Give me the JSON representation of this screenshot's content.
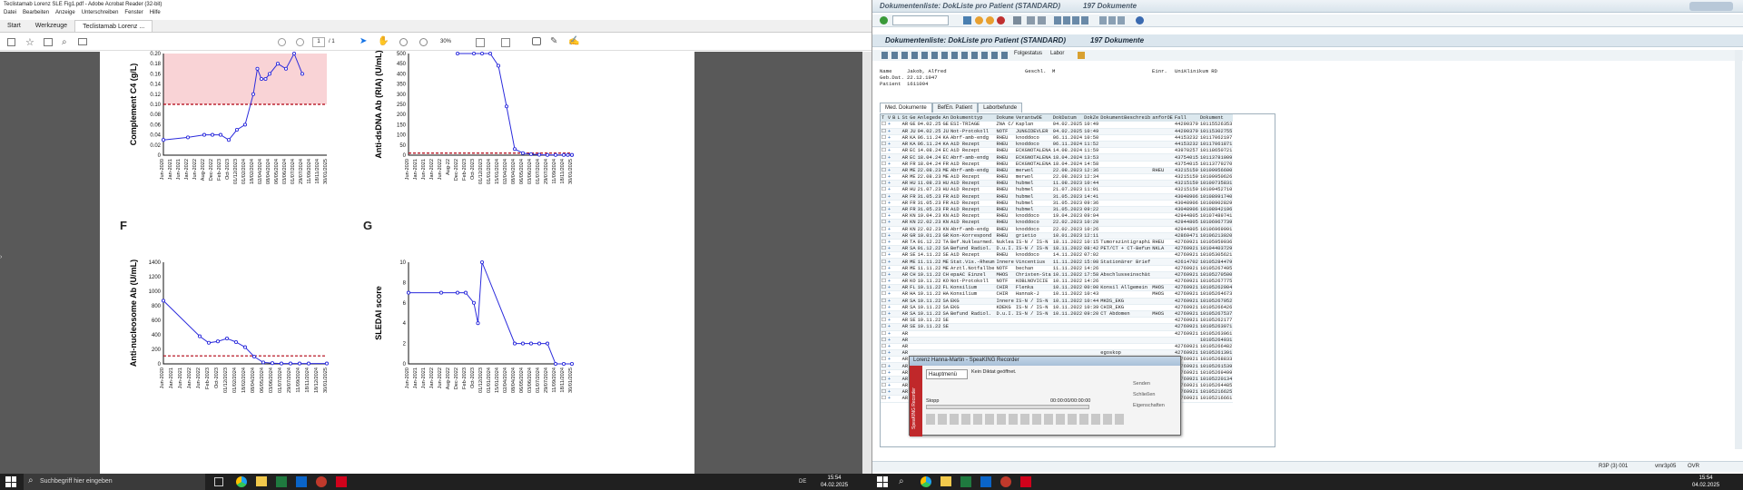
{
  "acrobat": {
    "title": "Teclistamab Lorenz SLE Fig1.pdf - Adobe Acrobat Reader (32-bit)",
    "menu": [
      "Datei",
      "Bearbeiten",
      "Anzeige",
      "Unterschreiben",
      "Fenster",
      "Hilfe"
    ],
    "tabs": [
      "Start",
      "Werkzeuge",
      "Teclistamab Lorenz ..."
    ],
    "page_current": "1",
    "page_total": "/ 1",
    "zoom": "30%"
  },
  "taskbar_left": {
    "search_placeholder": "Suchbegriff hier eingeben",
    "time": "15:54",
    "date": "04.02.2025",
    "lang": "DE"
  },
  "taskbar_right": {
    "time": "15:54",
    "date": "04.02.2025"
  },
  "panel_labels": {
    "f": "F",
    "g": "G"
  },
  "chart_data": [
    {
      "type": "line",
      "ylabel": "Complement C4 (g/L)",
      "yticks": [
        "0",
        "0.02",
        "0.04",
        "0.06",
        "0.08",
        "0.10",
        "0.12",
        "0.14",
        "0.16",
        "0.18",
        "0.20"
      ],
      "ylim": [
        0,
        0.2
      ],
      "threshold": 0.1,
      "x_labels": [
        "Jun-2020",
        "Jan-2021",
        "Jun-2021",
        "Jan-2022",
        "Jun-2022",
        "Aug-2022",
        "Dec-2022",
        "Feb-2023",
        "Oct-2023",
        "01/12/2023",
        "01/02/2024",
        "18/02/2024",
        "02/04/2024",
        "08/04/2024",
        "06/05/2024",
        "03/06/2024",
        "01/07/2024",
        "29/07/2024",
        "11/09/2024",
        "18/11/2024",
        "30/01/2025"
      ],
      "values": [
        0.03,
        0.035,
        0.04,
        0.04,
        0.04,
        0.03,
        0.05,
        0.06,
        0.12,
        0.17,
        0.15,
        0.15,
        0.16,
        0.18,
        0.17,
        0.2,
        0.16
      ],
      "x_index": [
        0,
        3,
        5,
        6,
        7,
        8,
        9,
        10,
        11,
        11.5,
        12,
        12.5,
        13,
        14,
        15,
        16,
        17,
        18,
        19,
        19.5,
        20
      ]
    },
    {
      "type": "line",
      "ylabel": "Anti-dsDNA Ab (RIA) (U/mL)",
      "yticks": [
        "0",
        "50",
        "100",
        "150",
        "200",
        "250",
        "300",
        "350",
        "400",
        "450",
        "500"
      ],
      "ylim": [
        0,
        500
      ],
      "threshold": 10,
      "x_labels": [
        "Jun-2020",
        "Jan-2021",
        "Jun-2021",
        "Jan-2022",
        "Jun-2022",
        "Aug-22",
        "Dec-2022",
        "Feb-2023",
        "Oct-2023",
        "01/12/2023",
        "01/01/2024",
        "15/01/2024",
        "02/04/2024",
        "08/04/2024",
        "06/05/2024",
        "03/06/2024",
        "01/07/2024",
        "29/07/2024",
        "11/09/2024",
        "18/11/2024",
        "30/01/2025"
      ],
      "values": [
        525,
        510,
        520,
        500,
        440,
        240,
        30,
        10,
        5,
        2,
        1,
        1,
        1,
        1,
        1,
        1
      ],
      "x_index": [
        6,
        8,
        9,
        10,
        11,
        12,
        13,
        14,
        15,
        16,
        17,
        18,
        19,
        19.5,
        20,
        20
      ]
    },
    {
      "type": "line",
      "ylabel": "Anti-nucleosome Ab (U/mL)",
      "yticks": [
        "0",
        "200",
        "400",
        "600",
        "800",
        "1000",
        "1200",
        "1400"
      ],
      "ylim": [
        0,
        1400
      ],
      "threshold": 110,
      "x_labels": [
        "Jun-2020",
        "Jan-2021",
        "Jun-2021",
        "Jan-2022",
        "Jun-2022",
        "Feb-2023",
        "Oct-2023",
        "01/12/2023",
        "01/02/2024",
        "18/02/2024",
        "08/04/2024",
        "06/05/2024",
        "03/06/2024",
        "01/07/2024",
        "29/07/2024",
        "11/09/2024",
        "18/11/2024",
        "18/12/2024",
        "30/01/2025"
      ],
      "values": [
        870,
        380,
        290,
        310,
        350,
        300,
        230,
        100,
        20,
        10,
        5,
        5,
        5,
        5,
        5
      ],
      "x_index": [
        0,
        4,
        5,
        6,
        7,
        8,
        9,
        10,
        11,
        12,
        13,
        14,
        15,
        16,
        18
      ]
    },
    {
      "type": "line",
      "ylabel": "SLEDAI score",
      "yticks": [
        "0",
        "2",
        "4",
        "6",
        "8",
        "10"
      ],
      "ylim": [
        0,
        10
      ],
      "x_labels": [
        "Jun-2020",
        "Jan-2021",
        "Jun-2021",
        "Jan-2022",
        "Jun-2022",
        "Aug-2022",
        "Dec-2022",
        "Feb-2023",
        "Oct-2023",
        "01/12/2023",
        "01/01/2024",
        "15/01/2024",
        "02/04/2024",
        "08/04/2024",
        "06/05/2024",
        "03/06/2024",
        "01/07/2024",
        "29/07/2024",
        "11/09/2024",
        "18/11/2024",
        "30/01/2025"
      ],
      "values": [
        7,
        7,
        7,
        7,
        6,
        4,
        10,
        2,
        2,
        2,
        2,
        2,
        0,
        0,
        0
      ],
      "x_index": [
        0,
        4,
        6,
        7,
        8,
        8.5,
        9,
        13,
        14,
        15,
        16,
        17,
        18,
        19,
        20
      ]
    }
  ],
  "sap": {
    "title": "Dokumentenliste: DokListe pro Patient (STANDARD)",
    "count": "197 Dokumente",
    "folgestatus": "Folgestatus",
    "labor": "Labor",
    "name_label": "Name",
    "name": "Jakob, Alfred",
    "geschl_label": "Geschl.",
    "geschl": "M",
    "einr_label": "Einr.",
    "einr": "UniKlinikum RD",
    "gebdat_label": "Geb.Dat.",
    "gebdat": "22.12.1947",
    "patient_label": "Patient",
    "patient": "1611094",
    "tabs": [
      "Med. Dokumente",
      "BefEn. Patient",
      "Laborbefunde"
    ],
    "columns": [
      "T",
      "V",
      "B",
      "L",
      "St",
      "Ge",
      "Anlegede",
      "An",
      "Dokumenttyp",
      "Dokume",
      "VerantwOE",
      "DokDatum",
      "DokZe",
      "DokumentBeschreib",
      "anforOE",
      "Fall",
      "Dokument"
    ],
    "rows": [
      [
        "AR",
        "GE",
        "04.02.25",
        "GE",
        "ESI-TRIAGE",
        "ZNA C/",
        "Kaplan",
        "04.02.2025",
        "10:49",
        "",
        "",
        "44290379",
        "10115526353"
      ],
      [
        "AR",
        "JU",
        "04.02.25",
        "JU",
        "Not-Protokoll",
        "NOTF",
        "JUNGIDEVLER",
        "04.02.2025",
        "10:49",
        "",
        "",
        "44290379",
        "10115302755"
      ],
      [
        "AR",
        "KA",
        "06.11.24",
        "KA",
        "Abrf-amb-endg",
        "RHEU",
        "knoddoco",
        "06.11.2024",
        "10:50",
        "",
        "",
        "44153232",
        "10117062197"
      ],
      [
        "AR",
        "KA",
        "06.11.24",
        "KA",
        "AiD Rezept",
        "RHEU",
        "knoddoco",
        "06.11.2024",
        "11:52",
        "",
        "",
        "44153232",
        "10117061871"
      ],
      [
        "AR",
        "EC",
        "14.08.24",
        "EC",
        "AiD Rezept",
        "RHEU",
        "ECKGNOTALENA",
        "14.08.2024",
        "11:59",
        "",
        "",
        "43970257",
        "10118650721"
      ],
      [
        "AR",
        "EC",
        "18.04.24",
        "EC",
        "Abrf-amb-endg",
        "RHEU",
        "ECKGNOTALENA",
        "18.04.2024",
        "13:53",
        "",
        "",
        "43754015",
        "10113781009"
      ],
      [
        "AR",
        "FR",
        "18.04.24",
        "FR",
        "AiD Rezept",
        "RHEU",
        "ECKGNOTALENA",
        "18.04.2024",
        "14:58",
        "",
        "",
        "43754015",
        "10113779270"
      ],
      [
        "AR",
        "ME",
        "22.08.23",
        "ME",
        "Abrf-amb-endg",
        "RHEU",
        "merwol",
        "22.08.2023",
        "12:36",
        "",
        "RHEU",
        "43215159",
        "10109956600"
      ],
      [
        "AR",
        "ME",
        "22.08.23",
        "ME",
        "AiD Rezept",
        "RHEU",
        "merwol",
        "22.08.2023",
        "12:34",
        "",
        "",
        "43215159",
        "10109950626"
      ],
      [
        "AR",
        "HU",
        "11.08.23",
        "HU",
        "AiD Rezept",
        "RHEU",
        "hubmel",
        "11.08.2023",
        "10:44",
        "",
        "",
        "43215159",
        "10109735831"
      ],
      [
        "AR",
        "HU",
        "21.07.23",
        "HU",
        "AiD Rezept",
        "RHEU",
        "hubmel",
        "21.07.2023",
        "11:01",
        "",
        "",
        "43215159",
        "10109452710"
      ],
      [
        "AR",
        "FR",
        "31.05.23",
        "FR",
        "AiD Rezept",
        "RHEU",
        "hubmel",
        "31.05.2023",
        "14:41",
        "",
        "",
        "43048906",
        "10108991740"
      ],
      [
        "AR",
        "FR",
        "31.05.23",
        "FR",
        "AiD Rezept",
        "RHEU",
        "hubmel",
        "31.05.2023",
        "09:36",
        "",
        "",
        "43048906",
        "10108902829"
      ],
      [
        "AR",
        "FR",
        "31.05.23",
        "FR",
        "AiD Rezept",
        "RHEU",
        "hubmel",
        "31.05.2023",
        "09:22",
        "",
        "",
        "43048906",
        "10108942196"
      ],
      [
        "AR",
        "KN",
        "19.04.23",
        "KN",
        "AiD Rezept",
        "RHEU",
        "knoddoco",
        "19.04.2023",
        "09:04",
        "",
        "",
        "42944805",
        "10107489741"
      ],
      [
        "AR",
        "KN",
        "22.02.23",
        "KN",
        "AiD Rezept",
        "RHEU",
        "knoddoco",
        "22.02.2023",
        "10:20",
        "",
        "",
        "42944805",
        "10106967739"
      ],
      [
        "AR",
        "KN",
        "22.02.23",
        "KN",
        "Abrf-amb-endg",
        "RHEU",
        "knoddoco",
        "22.02.2023",
        "10:26",
        "",
        "",
        "42944805",
        "10106969991"
      ],
      [
        "AR",
        "GR",
        "10.01.23",
        "GR",
        "Kon-Korrespond",
        "RHEU",
        "grietio",
        "10.01.2023",
        "12:11",
        "",
        "",
        "42869471",
        "10106213020"
      ],
      [
        "AR",
        "TA",
        "01.12.22",
        "TA",
        "Bef.Nuklearmed.",
        "Nuklea",
        "IS-N / IS-N",
        "18.11.2022",
        "10:15",
        "Tumorszintigraphi",
        "RHEU",
        "42769921",
        "10105959936"
      ],
      [
        "AR",
        "SA",
        "01.12.22",
        "SA",
        "Befund Radiol.",
        "D.u.I.",
        "IS-N / IS-N",
        "18.11.2022",
        "08:42",
        "PET/CT + CT-Befun",
        "NKLA",
        "42769921",
        "10104403729"
      ],
      [
        "AR",
        "SE",
        "14.11.22",
        "SE",
        "AiD Rezept",
        "RHEU",
        "knoddoco",
        "14.11.2022",
        "07:02",
        "",
        "",
        "42769921",
        "10105305621"
      ],
      [
        "AR",
        "ME",
        "11.11.22",
        "ME",
        "Stat.Vis.-Rheum",
        "Innere",
        "Vincentius",
        "11.11.2022",
        "15:08",
        "Stationärer Brief",
        "",
        "42614702",
        "10105284479"
      ],
      [
        "AR",
        "ME",
        "11.11.22",
        "ME",
        "Arztl.Notfallbe",
        "NOTF",
        "bechan",
        "11.11.2022",
        "14:26",
        "",
        "",
        "42769921",
        "10105267495"
      ],
      [
        "AR",
        "CH",
        "10.11.22",
        "CH",
        "epaAC Einzel",
        "MHOS",
        "Christen-Sta",
        "10.11.2022",
        "17:58",
        "Abschlusseinschät",
        "",
        "42769921",
        "10105270500"
      ],
      [
        "AR",
        "KO",
        "10.11.22",
        "KO",
        "Not-Protokoll",
        "NOTF",
        "KOBLNOVICIE",
        "10.11.2022",
        "14:26",
        "",
        "",
        "42769921",
        "10105267775"
      ],
      [
        "AR",
        "FL",
        "10.11.22",
        "FL",
        "Konsilium",
        "CHIR",
        "Flenka",
        "10.11.2022",
        "00:00",
        "Konsil Allgemein",
        "MHOS",
        "42769921",
        "10105262904"
      ],
      [
        "AR",
        "HA",
        "10.11.22",
        "HA",
        "Konsilium",
        "CHIR",
        "Hannak-J",
        "10.11.2022",
        "10:43",
        "",
        "MHOS",
        "42769921",
        "10105264673"
      ],
      [
        "AR",
        "SA",
        "10.11.22",
        "SA",
        "EKG",
        "Innere",
        "IS-N / IS-N",
        "10.11.2022",
        "10:44",
        "MKDS_EKG",
        "",
        "42769921",
        "10105267952"
      ],
      [
        "AR",
        "SA",
        "10.11.22",
        "SA",
        "EKG",
        "KDEKG",
        "IS-N / IS-N",
        "10.11.2022",
        "10:39",
        "CHIR_EKG",
        "",
        "42769921",
        "10105266426"
      ],
      [
        "AR",
        "SA",
        "10.11.22",
        "SA",
        "Befund Radiol.",
        "D.u.I.",
        "IS-N / IS-N",
        "10.11.2022",
        "09:20",
        "CT Abdomen",
        "MHOS",
        "42769921",
        "10105267537"
      ],
      [
        "AR",
        "SE",
        "10.11.22",
        "SE",
        "",
        "",
        "",
        "",
        "",
        "",
        "",
        "42769921",
        "10105262177"
      ],
      [
        "AR",
        "SE",
        "10.11.22",
        "SE",
        "",
        "",
        "",
        "",
        "",
        "",
        "",
        "42769921",
        "10105263071"
      ],
      [
        "AR",
        "",
        "",
        "",
        "",
        "",
        "",
        "",
        "",
        "",
        "",
        "42769921",
        "10105263061"
      ],
      [
        "AR",
        "",
        "",
        "",
        "",
        "",
        "",
        "",
        "",
        "",
        "",
        "",
        "10105264931"
      ],
      [
        "AR",
        "",
        "",
        "",
        "",
        "",
        "",
        "",
        "",
        "",
        "",
        "42769921",
        "10105266482"
      ],
      [
        "AR",
        "",
        "",
        "",
        "",
        "",
        "",
        "",
        "",
        "egoskop",
        "",
        "42769921",
        "10105261391"
      ],
      [
        "AR",
        "",
        "",
        "",
        "",
        "",
        "",
        "",
        "",
        "",
        "",
        "42769921",
        "10105268833"
      ],
      [
        "AR",
        "",
        "",
        "",
        "",
        "",
        "",
        "",
        "",
        "",
        "DRHC",
        "42769921",
        "10105261539"
      ],
      [
        "AR",
        "",
        "",
        "",
        "",
        "",
        "",
        "",
        "",
        "",
        "",
        "42769921",
        "10105269499"
      ],
      [
        "AR",
        "",
        "",
        "",
        "",
        "",
        "",
        "",
        "",
        "",
        "DRHC",
        "42769921",
        "10105220134"
      ],
      [
        "AR",
        "",
        "",
        "",
        "",
        "",
        "",
        "",
        "",
        "ief",
        "",
        "42769921",
        "10105264485"
      ],
      [
        "AR",
        "",
        "",
        "",
        "",
        "",
        "",
        "",
        "",
        "",
        "",
        "42769921",
        "10105216625"
      ],
      [
        "AR",
        "MU",
        "08.11.22",
        "MU",
        "epaAC Einzel",
        "MHOS",
        "szcideni",
        "08.11.2022",
        "13:14",
        "Ersteinschätzung",
        "",
        "42769921",
        "10105216661"
      ]
    ],
    "status": {
      "server": "R3P (3) 001",
      "user": "vmr3p05",
      "mode": "OVR"
    }
  },
  "speakmagic": {
    "title": "Lorenz Hanna-Martin - SpeaKING Recorder",
    "menu": "Hauptmenü",
    "status": "Kein Diktat geöffnet.",
    "stopp": "Stopp",
    "time": "00:00:00/00:00:00",
    "buttons": [
      "Senden",
      "Schließen",
      "Eigenschaften"
    ],
    "side_label": "SpeaKING Recorder"
  }
}
